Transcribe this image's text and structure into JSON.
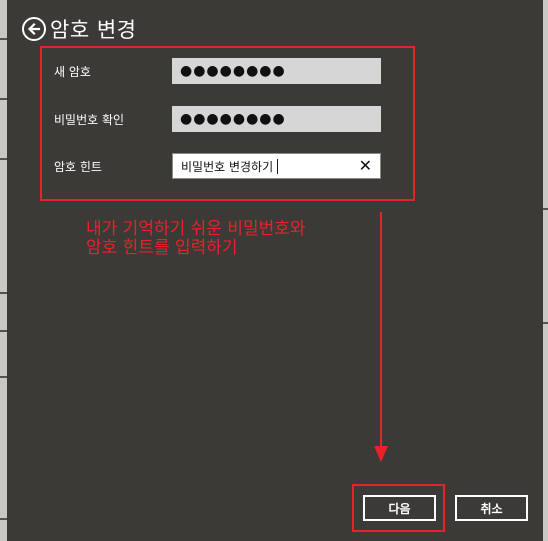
{
  "header": {
    "title": "암호 변경",
    "back_icon": "back-arrow-circle-icon"
  },
  "form": {
    "new_password": {
      "label": "새 암호",
      "value": "●●●●●●●●"
    },
    "confirm_password": {
      "label": "비밀번호 확인",
      "value": "●●●●●●●●"
    },
    "password_hint": {
      "label": "암호 힌트",
      "value": "비밀번호 변경하기",
      "clear_icon": "✕"
    }
  },
  "annotation": {
    "text": "내가 기억하기 쉬운 비밀번호와\n암호 힌트를 입력하기",
    "color": "#e8222b"
  },
  "footer": {
    "next_label": "다음",
    "cancel_label": "취소"
  },
  "colors": {
    "background": "#3b3a37",
    "accent_red": "#e8222b"
  }
}
